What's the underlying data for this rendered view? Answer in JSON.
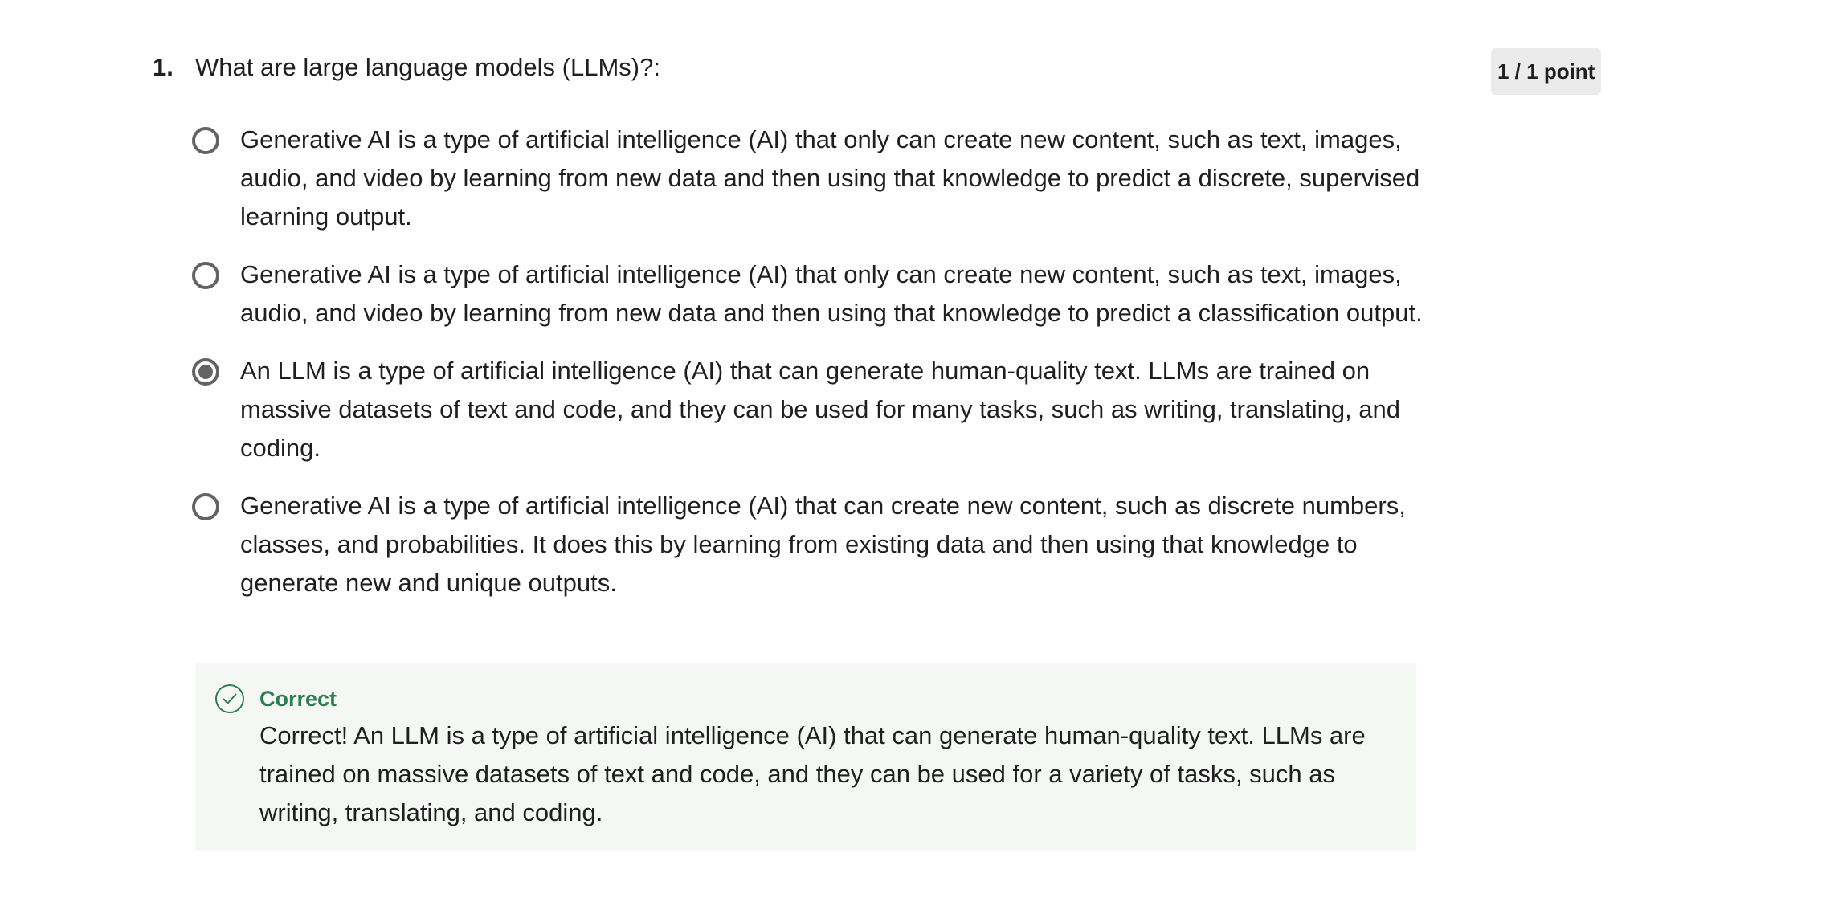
{
  "question": {
    "number": "1.",
    "text": "What are large language models (LLMs)?:",
    "points": "1 / 1 point"
  },
  "options": [
    {
      "text": "Generative AI is a type of artificial intelligence (AI) that only can create new content, such as text, images, audio, and video by learning from new data and then using that knowledge to predict a discrete, supervised learning output.",
      "selected": false
    },
    {
      "text": "Generative AI is a type of artificial intelligence (AI) that only can create new content, such as text, images, audio, and video by learning from new data and then using that knowledge to predict a classification output.",
      "selected": false
    },
    {
      "text": "An LLM is a type of artificial intelligence (AI) that can generate human-quality text. LLMs are trained on massive datasets of text and code, and they can be used for many tasks, such as writing, translating, and coding.",
      "selected": true
    },
    {
      "text": "Generative AI is a type of artificial intelligence (AI) that can create new content, such as discrete numbers, classes, and probabilities. It does this by learning from existing data and then using that knowledge to generate new and unique outputs.",
      "selected": false
    }
  ],
  "feedback": {
    "status": "Correct",
    "message": "Correct! An LLM is a type of artificial intelligence (AI) that can generate human-quality text. LLMs are trained on massive datasets of text and code, and they can be used for a variety of tasks, such as writing, translating, and coding.",
    "icon": "check-circle-icon",
    "color": "#2e7d4f"
  }
}
